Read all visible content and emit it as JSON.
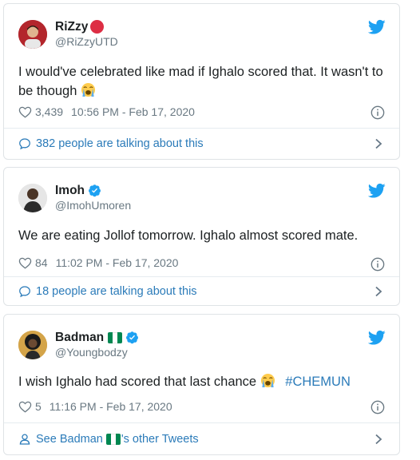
{
  "tweets": [
    {
      "name": "RiZzy",
      "handle": "@RiZzyUTD",
      "text": "I would've celebrated like mad if Ighalo scored that. It wasn't to be though",
      "likes": "3,439",
      "timestamp": "10:56 PM - Feb 17, 2020",
      "footer": "382 people are talking about this"
    },
    {
      "name": "Imoh",
      "handle": "@ImohUmoren",
      "text": "We are eating Jollof tomorrow. Ighalo almost scored mate.",
      "likes": "84",
      "timestamp": "11:02 PM - Feb 17, 2020",
      "footer": "18 people are talking about this"
    },
    {
      "name": "Badman",
      "handle": "@Youngbodzy",
      "text": "I wish Ighalo had scored that last chance",
      "hashtag": "#CHEMUN",
      "likes": "5",
      "timestamp": "11:16 PM - Feb 17, 2020",
      "footer_prefix": "See Badman",
      "footer_suffix": "'s other Tweets"
    }
  ],
  "icons": {
    "twitter": "twitter-bird-icon",
    "like": "heart-icon",
    "info": "info-icon",
    "conversation": "chat-bubble-icon",
    "profile": "person-icon",
    "chevron": "chevron-right-icon",
    "verified": "verified-badge-icon",
    "emoji": "loudly-crying-face-emoji"
  },
  "colors": {
    "link": "#2b7bb9",
    "twitter_blue": "#1da1f2",
    "muted": "#697882",
    "border": "#dfe3e6",
    "record_red": "#dd2e44",
    "flag_green": "#008751"
  }
}
